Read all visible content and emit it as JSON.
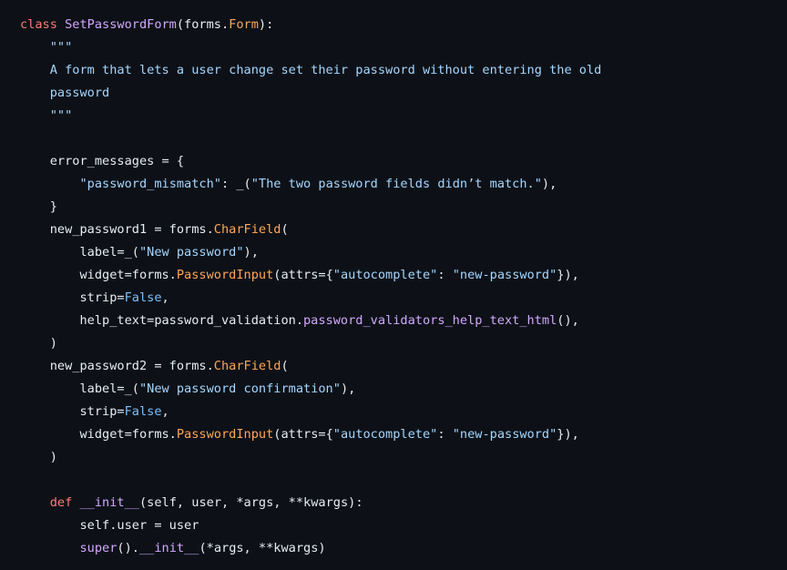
{
  "code": {
    "language": "python",
    "colors": {
      "background": "#0d1117",
      "plain": "#e6edf3",
      "keyword": "#ff7b72",
      "function": "#d2a8ff",
      "class": "#ffa657",
      "string": "#a5d6ff",
      "constant": "#79c0ff"
    },
    "lines": [
      [
        {
          "t": "class",
          "c": "kw"
        },
        {
          "t": " ",
          "c": "plain"
        },
        {
          "t": "SetPasswordForm",
          "c": "fn"
        },
        {
          "t": "(forms.",
          "c": "plain"
        },
        {
          "t": "Form",
          "c": "cls"
        },
        {
          "t": "):",
          "c": "plain"
        }
      ],
      [
        {
          "t": "    \"\"\"",
          "c": "str"
        }
      ],
      [
        {
          "t": "    A form that lets a user change set their password without entering the old",
          "c": "str"
        }
      ],
      [
        {
          "t": "    password",
          "c": "str"
        }
      ],
      [
        {
          "t": "    \"\"\"",
          "c": "str"
        }
      ],
      [],
      [
        {
          "t": "    error_messages = {",
          "c": "plain"
        }
      ],
      [
        {
          "t": "        ",
          "c": "plain"
        },
        {
          "t": "\"password_mismatch\"",
          "c": "str"
        },
        {
          "t": ": _(",
          "c": "plain"
        },
        {
          "t": "\"The two password fields didn’t match.\"",
          "c": "str"
        },
        {
          "t": "),",
          "c": "plain"
        }
      ],
      [
        {
          "t": "    }",
          "c": "plain"
        }
      ],
      [
        {
          "t": "    new_password1 = forms.",
          "c": "plain"
        },
        {
          "t": "CharField",
          "c": "cls"
        },
        {
          "t": "(",
          "c": "plain"
        }
      ],
      [
        {
          "t": "        label=_(",
          "c": "plain"
        },
        {
          "t": "\"New password\"",
          "c": "str"
        },
        {
          "t": "),",
          "c": "plain"
        }
      ],
      [
        {
          "t": "        widget=forms.",
          "c": "plain"
        },
        {
          "t": "PasswordInput",
          "c": "cls"
        },
        {
          "t": "(attrs={",
          "c": "plain"
        },
        {
          "t": "\"autocomplete\"",
          "c": "str"
        },
        {
          "t": ": ",
          "c": "plain"
        },
        {
          "t": "\"new-password\"",
          "c": "str"
        },
        {
          "t": "}),",
          "c": "plain"
        }
      ],
      [
        {
          "t": "        strip=",
          "c": "plain"
        },
        {
          "t": "False",
          "c": "con"
        },
        {
          "t": ",",
          "c": "plain"
        }
      ],
      [
        {
          "t": "        help_text=password_validation.",
          "c": "plain"
        },
        {
          "t": "password_validators_help_text_html",
          "c": "fn"
        },
        {
          "t": "(),",
          "c": "plain"
        }
      ],
      [
        {
          "t": "    )",
          "c": "plain"
        }
      ],
      [
        {
          "t": "    new_password2 = forms.",
          "c": "plain"
        },
        {
          "t": "CharField",
          "c": "cls"
        },
        {
          "t": "(",
          "c": "plain"
        }
      ],
      [
        {
          "t": "        label=_(",
          "c": "plain"
        },
        {
          "t": "\"New password confirmation\"",
          "c": "str"
        },
        {
          "t": "),",
          "c": "plain"
        }
      ],
      [
        {
          "t": "        strip=",
          "c": "plain"
        },
        {
          "t": "False",
          "c": "con"
        },
        {
          "t": ",",
          "c": "plain"
        }
      ],
      [
        {
          "t": "        widget=forms.",
          "c": "plain"
        },
        {
          "t": "PasswordInput",
          "c": "cls"
        },
        {
          "t": "(attrs={",
          "c": "plain"
        },
        {
          "t": "\"autocomplete\"",
          "c": "str"
        },
        {
          "t": ": ",
          "c": "plain"
        },
        {
          "t": "\"new-password\"",
          "c": "str"
        },
        {
          "t": "}),",
          "c": "plain"
        }
      ],
      [
        {
          "t": "    )",
          "c": "plain"
        }
      ],
      [],
      [
        {
          "t": "    ",
          "c": "plain"
        },
        {
          "t": "def",
          "c": "kw"
        },
        {
          "t": " ",
          "c": "plain"
        },
        {
          "t": "__init__",
          "c": "fn"
        },
        {
          "t": "(self, user, *args, **kwargs):",
          "c": "plain"
        }
      ],
      [
        {
          "t": "        self.user = user",
          "c": "plain"
        }
      ],
      [
        {
          "t": "        ",
          "c": "plain"
        },
        {
          "t": "super",
          "c": "fn"
        },
        {
          "t": "().",
          "c": "plain"
        },
        {
          "t": "__init__",
          "c": "fn"
        },
        {
          "t": "(*args, **kwargs)",
          "c": "plain"
        }
      ]
    ]
  }
}
